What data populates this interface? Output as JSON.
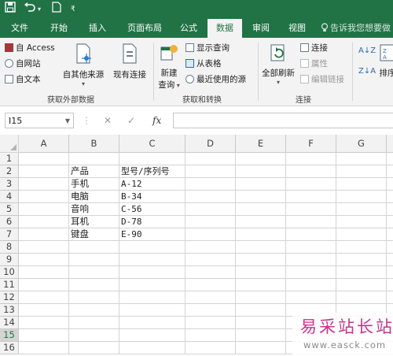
{
  "quick_access": {
    "save_icon": "save-icon",
    "undo_icon": "undo-icon",
    "redo_dropdown_icon": "chevron-down-icon",
    "new_file_icon": "new-file-icon",
    "customize_icon": "customize-icon"
  },
  "tabs": [
    "文件",
    "开始",
    "插入",
    "页面布局",
    "公式",
    "数据",
    "审阅",
    "视图"
  ],
  "active_tab": "数据",
  "tell_me": "告诉我您想要做",
  "ribbon": {
    "get_external": {
      "access": "自 Access",
      "web": "自网站",
      "text": "自文本",
      "other": "自其他来源",
      "existing": "现有连接",
      "label": "获取外部数据"
    },
    "get_transform": {
      "new_query": "新建",
      "new_query_2": "查询",
      "show_queries": "显示查询",
      "from_table": "从表格",
      "recent": "最近使用的源",
      "label": "获取和转换"
    },
    "connections": {
      "refresh_all": "全部刷新",
      "connections": "连接",
      "properties": "属性",
      "edit_links": "编辑链接",
      "label": "连接"
    },
    "sort": {
      "sort_label": "排序"
    }
  },
  "formula_bar": {
    "name_box": "I15",
    "cancel": "✕",
    "enter": "✓",
    "fx": "fx",
    "value": ""
  },
  "columns": [
    "A",
    "B",
    "C",
    "D",
    "E",
    "F",
    "G"
  ],
  "rows": [
    "1",
    "2",
    "3",
    "4",
    "5",
    "6",
    "7",
    "8",
    "9",
    "10",
    "11",
    "12",
    "13",
    "14",
    "15",
    "16"
  ],
  "selected_row": "15",
  "cells": {
    "B2": "产品",
    "C2": "型号/序列号",
    "B3": "手机",
    "C3": "A-12",
    "B4": "电脑",
    "C4": "B-34",
    "B5": "音响",
    "C5": "C-56",
    "B6": "耳机",
    "C6": "D-78",
    "B7": "键盘",
    "C7": "E-90"
  },
  "watermark": {
    "title": "易采站长站",
    "url": "www.easck.com"
  }
}
